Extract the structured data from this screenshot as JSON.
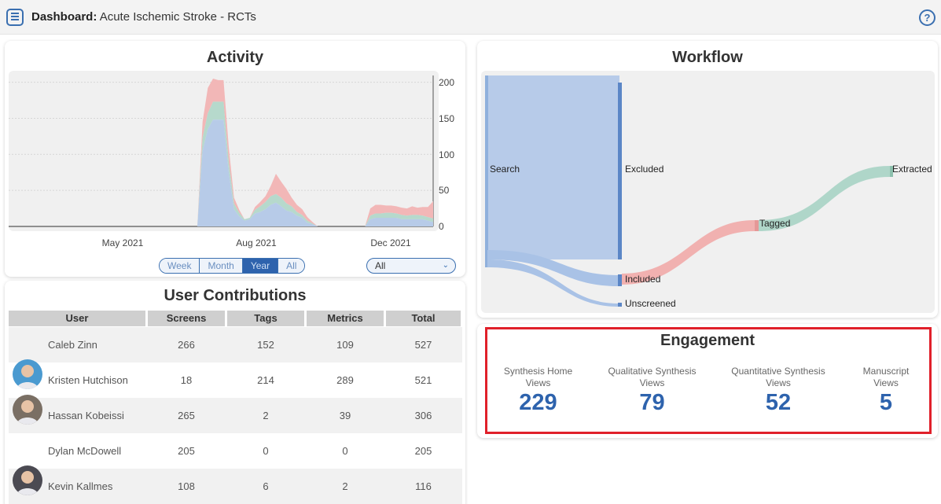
{
  "header": {
    "label": "Dashboard:",
    "title": "Acute Ischemic Stroke - RCTs",
    "help_glyph": "?",
    "menu_icon": "hamburger-menu-icon",
    "help_icon": "help-circle-icon"
  },
  "activity": {
    "title": "Activity",
    "range_tabs": [
      "Week",
      "Month",
      "Year",
      "All"
    ],
    "selected_tab": "Year",
    "filter_value": "All",
    "chart_data": {
      "type": "area",
      "x_ticks": [
        "May 2021",
        "Aug 2021",
        "Dec 2021"
      ],
      "y_ticks": [
        200,
        150,
        100,
        50,
        0
      ],
      "ylim": [
        0,
        205
      ],
      "grid": true,
      "colors": {
        "blue": "#b7cbe8",
        "green": "#b6d9cc",
        "red": "#f2b7b7"
      },
      "series": [
        {
          "values": [
            0,
            0,
            0,
            0,
            0,
            0,
            0,
            0,
            0,
            0,
            0,
            0,
            0,
            0,
            0,
            0,
            0,
            0,
            0,
            0,
            0,
            0,
            0,
            0,
            0,
            0,
            0,
            0,
            0,
            0,
            0,
            0,
            0,
            0,
            0,
            0,
            0,
            105,
            135,
            148,
            148,
            148,
            75,
            24,
            14,
            8,
            10,
            18,
            20,
            24,
            30,
            33,
            28,
            22,
            20,
            15,
            12,
            5,
            3,
            0,
            0,
            0,
            0,
            0,
            0,
            0,
            0,
            0,
            0,
            10,
            12,
            12,
            12,
            12,
            12,
            10,
            10,
            10,
            10,
            10,
            8,
            6
          ]
        },
        {
          "values": [
            0,
            0,
            0,
            0,
            0,
            0,
            0,
            0,
            0,
            0,
            0,
            0,
            0,
            0,
            0,
            0,
            0,
            0,
            0,
            0,
            0,
            0,
            0,
            0,
            0,
            0,
            0,
            0,
            0,
            0,
            0,
            0,
            0,
            0,
            0,
            0,
            0,
            18,
            22,
            25,
            25,
            25,
            15,
            8,
            5,
            2,
            2,
            5,
            8,
            10,
            12,
            12,
            12,
            10,
            8,
            5,
            4,
            3,
            1,
            0,
            0,
            0,
            0,
            0,
            0,
            0,
            0,
            0,
            0,
            5,
            6,
            6,
            7,
            7,
            6,
            6,
            5,
            6,
            6,
            5,
            5,
            5
          ]
        },
        {
          "values": [
            0,
            0,
            0,
            0,
            0,
            0,
            0,
            0,
            0,
            0,
            0,
            0,
            0,
            0,
            0,
            0,
            0,
            0,
            0,
            0,
            0,
            0,
            0,
            0,
            0,
            0,
            0,
            0,
            0,
            0,
            0,
            0,
            0,
            0,
            0,
            0,
            0,
            22,
            35,
            32,
            30,
            30,
            20,
            8,
            4,
            0,
            0,
            4,
            6,
            8,
            14,
            28,
            22,
            20,
            12,
            10,
            8,
            5,
            2,
            0,
            0,
            0,
            0,
            0,
            0,
            0,
            0,
            0,
            0,
            10,
            12,
            12,
            10,
            10,
            10,
            10,
            10,
            12,
            10,
            12,
            14,
            24
          ]
        }
      ]
    }
  },
  "contributions": {
    "title": "User Contributions",
    "columns": [
      "User",
      "Screens",
      "Tags",
      "Metrics",
      "Total"
    ],
    "rows": [
      {
        "user": "Caleb Zinn",
        "screens": "266",
        "tags": "152",
        "metrics": "109",
        "total": "527",
        "avatar": false
      },
      {
        "user": "Kristen Hutchison",
        "screens": "18",
        "tags": "214",
        "metrics": "289",
        "total": "521",
        "avatar": true,
        "avatar_color": "#4a9ad0"
      },
      {
        "user": "Hassan Kobeissi",
        "screens": "265",
        "tags": "2",
        "metrics": "39",
        "total": "306",
        "avatar": true,
        "avatar_color": "#7a6f64"
      },
      {
        "user": "Dylan McDowell",
        "screens": "205",
        "tags": "0",
        "metrics": "0",
        "total": "205",
        "avatar": false
      },
      {
        "user": "Kevin Kallmes",
        "screens": "108",
        "tags": "6",
        "metrics": "2",
        "total": "116",
        "avatar": true,
        "avatar_color": "#4b4a52"
      }
    ]
  },
  "workflow": {
    "title": "Workflow",
    "nodes": [
      "Search",
      "Excluded",
      "Included",
      "Unscreened",
      "Tagged",
      "Extracted"
    ],
    "colors": {
      "search": "#a8c2e6",
      "excluded": "#b3c8e8",
      "to_tagged": "#f1aaa9",
      "to_extracted": "#a7d3c4"
    }
  },
  "engagement": {
    "title": "Engagement",
    "metrics": [
      {
        "label_1": "Synthesis Home",
        "label_2": "Views",
        "value": "229"
      },
      {
        "label_1": "Qualitative Synthesis",
        "label_2": "Views",
        "value": "79"
      },
      {
        "label_1": "Quantitative Synthesis",
        "label_2": "Views",
        "value": "52"
      },
      {
        "label_1": "Manuscript",
        "label_2": "Views",
        "value": "5"
      }
    ],
    "highlight_color": "#e0202a"
  }
}
